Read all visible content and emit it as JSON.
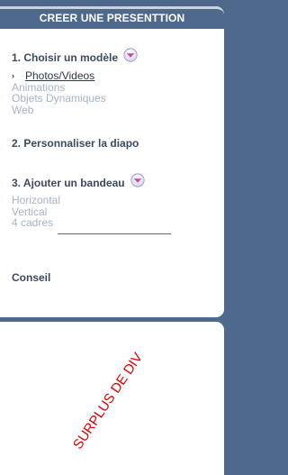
{
  "header": {
    "title": "CREER UNE PRESENTTION"
  },
  "step1": {
    "title": "1. Choisir un modèle",
    "dropdown_icon": "chevron-down-icon",
    "bullet": "›",
    "items": [
      "Photos/Videos",
      "Animations",
      "Objets Dynamiques",
      "Web"
    ],
    "active_index": 0
  },
  "step2": {
    "title": "2. Personnaliser la diapo"
  },
  "step3": {
    "title": "3. Ajouter un bandeau",
    "dropdown_icon": "chevron-down-icon",
    "items": [
      "Horizontal",
      "Vertical",
      "4 cadres"
    ]
  },
  "tip": {
    "title": "Conseil"
  },
  "surplus": {
    "text": "SURPLUS DE DIV"
  },
  "colors": {
    "header_bg": "#4e698b",
    "title_text": "#3b4a5e",
    "inactive_item": "#a6b3c4",
    "warning_text": "#e50000"
  }
}
